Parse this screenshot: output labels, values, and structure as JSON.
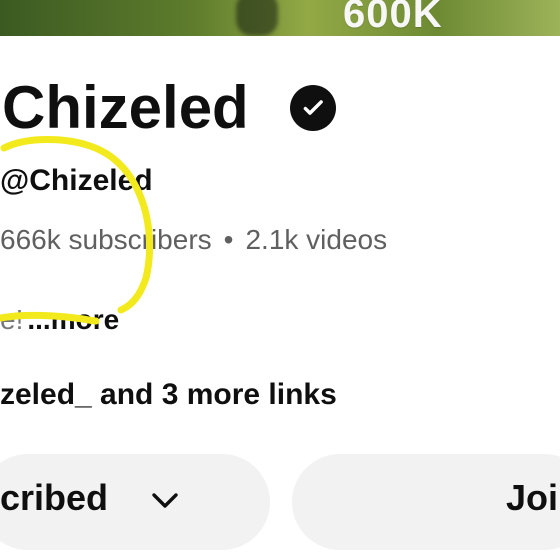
{
  "banner": {
    "overlay_text": "600K"
  },
  "channel": {
    "name": "Chizeled",
    "verified_icon": "verified-check-icon",
    "handle": "@Chizeled",
    "subscribers": "666k subscribers",
    "separator": "•",
    "videos": "2.1k videos",
    "description_prefix": "e!",
    "more_label": "...more",
    "links_text": "zeled_ and 3 more links"
  },
  "actions": {
    "subscribe_label": "cribed",
    "subscribe_icon": "chevron-down-icon",
    "join_label": "Joi"
  },
  "colors": {
    "banner_green": "#5f7d2c",
    "primary_text": "#0f0f0f",
    "secondary_text": "#606060",
    "button_bg": "#f2f2f2",
    "annotation_yellow": "#f2ea1d"
  }
}
